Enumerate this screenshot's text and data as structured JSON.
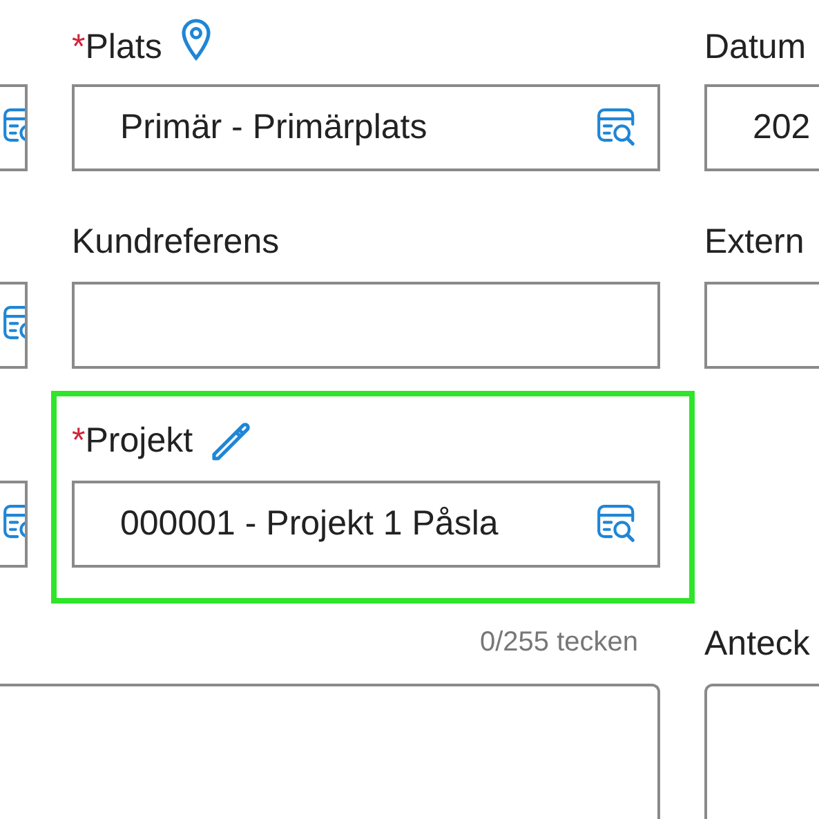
{
  "left_column": {
    "fields": [
      {
        "kind": "lookup"
      },
      {
        "kind": "lookup"
      },
      {
        "kind": "lookup"
      }
    ]
  },
  "main_column": {
    "fields": [
      {
        "label": "Plats",
        "required_mark": "*",
        "label_icon": {
          "kind": "pin"
        },
        "kind": "lookup",
        "value": "Primär - Primärplats",
        "highlighted": false
      },
      {
        "label": "Kundreferens",
        "kind": "text",
        "highlighted": false
      },
      {
        "label": "Projekt",
        "required_mark": "*",
        "label_icon": {
          "kind": "pencil"
        },
        "kind": "lookup",
        "value": "000001 - Projekt 1 Påsla",
        "highlighted": true
      }
    ],
    "char_counter": "0/255 tecken"
  },
  "right_column": {
    "fields": [
      {
        "label": "Datum",
        "value": "202"
      },
      {
        "label": "Extern"
      }
    ],
    "notes_label": "Anteck"
  }
}
